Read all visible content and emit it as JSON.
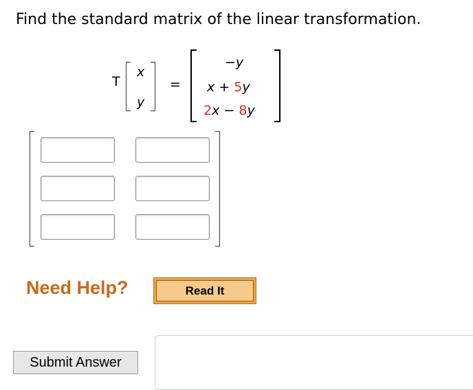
{
  "question": {
    "prompt": "Find the standard matrix of the linear transformation."
  },
  "transformation": {
    "func": "T",
    "input": [
      "x",
      "y"
    ],
    "equals": "=",
    "row1": {
      "sign": "−",
      "var": "y"
    },
    "row2": {
      "v1": "x",
      "op": "+",
      "coef": "5",
      "v2": "y"
    },
    "row3": {
      "coef1": "2",
      "v1": "x",
      "op": "−",
      "coef2": "8",
      "v2": "y"
    }
  },
  "answer_matrix": {
    "rows": 3,
    "cols": 2,
    "cells": [
      "",
      "",
      "",
      "",
      "",
      ""
    ]
  },
  "help": {
    "need_help": "Need Help?",
    "read_it": "Read It"
  },
  "actions": {
    "submit": "Submit Answer"
  },
  "colors": {
    "coefficient": "#e0241b",
    "need_help": "#c9681a",
    "read_it_button": "#f4a23a"
  }
}
